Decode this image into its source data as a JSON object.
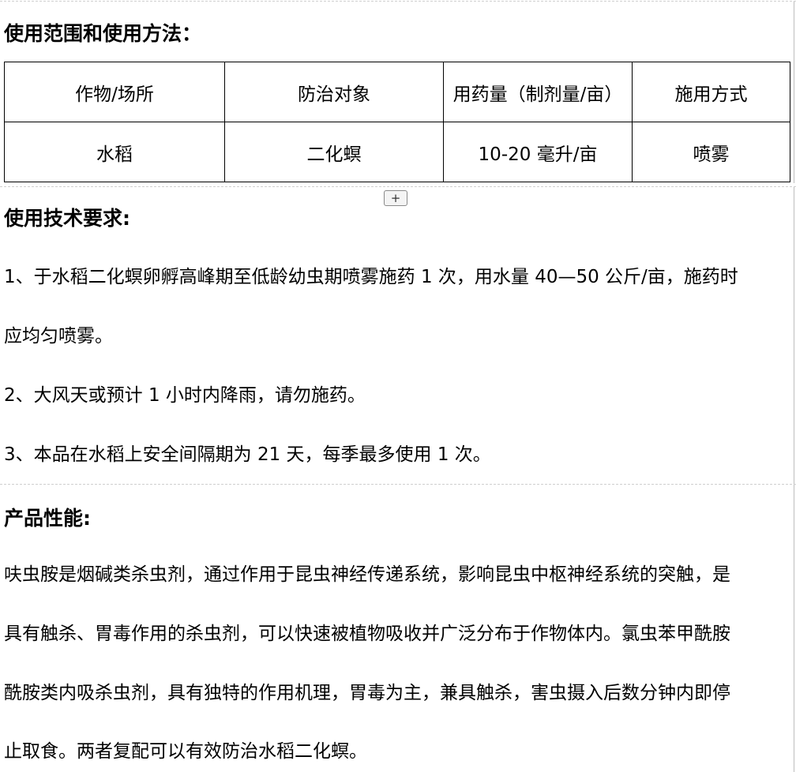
{
  "section_usage": {
    "heading": "使用范围和使用方法：",
    "table": {
      "headers": [
        "作物/场所",
        "防治对象",
        "用药量（制剂量/亩）",
        "施用方式"
      ],
      "rows": [
        [
          "水稻",
          "二化螟",
          "10-20 毫升/亩",
          "喷雾"
        ]
      ]
    },
    "add_button_label": "+"
  },
  "section_tech": {
    "heading": "使用技术要求:",
    "lines": [
      "1、于水稻二化螟卵孵高峰期至低龄幼虫期喷雾施药 1 次，用水量 40—50 公斤/亩，施药时",
      "应均匀喷雾。",
      "2、大风天或预计 1 小时内降雨，请勿施药。",
      "3、本品在水稻上安全间隔期为 21 天，每季最多使用 1 次。"
    ]
  },
  "section_performance": {
    "heading": "产品性能:",
    "lines": [
      "呋虫胺是烟碱类杀虫剂，通过作用于昆虫神经传递系统，影响昆虫中枢神经系统的突触，是",
      "具有触杀、胃毒作用的杀虫剂，可以快速被植物吸收并广泛分布于作物体内。氯虫苯甲酰胺",
      "酰胺类内吸杀虫剂，具有独特的作用机理，胃毒为主，兼具触杀，害虫摄入后数分钟内即停",
      "止取食。两者复配可以有效防治水稻二化螟。"
    ]
  }
}
